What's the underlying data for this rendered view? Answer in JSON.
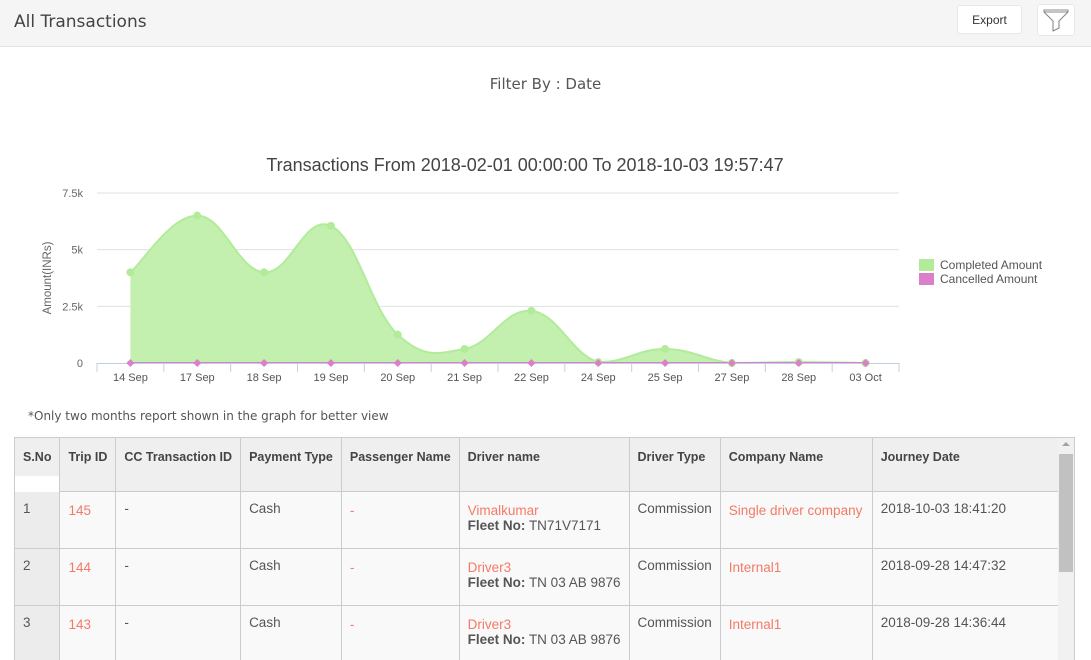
{
  "header": {
    "title": "All Transactions",
    "export_label": "Export",
    "filter_icon": "filter-funnel-icon"
  },
  "filter_by": "Filter By : Date",
  "note": "*Only two months report shown in the graph for better view",
  "colors": {
    "accent_link": "#f47a66",
    "completed": "#b2eb9a",
    "cancelled": "#dc7fcb"
  },
  "chart_data": {
    "type": "area",
    "title": "Transactions From 2018-02-01 00:00:00 To 2018-10-03 19:57:47",
    "xlabel": "",
    "ylabel": "Amount(INRs)",
    "ylim": [
      0,
      7500
    ],
    "yticks": [
      0,
      2500,
      5000,
      7500
    ],
    "ytick_labels": [
      "0",
      "2.5k",
      "5k",
      "7.5k"
    ],
    "grid": true,
    "legend_position": "right",
    "categories": [
      "14 Sep",
      "17 Sep",
      "18 Sep",
      "19 Sep",
      "20 Sep",
      "21 Sep",
      "22 Sep",
      "24 Sep",
      "25 Sep",
      "27 Sep",
      "28 Sep",
      "03 Oct"
    ],
    "series": [
      {
        "name": "Completed Amount",
        "values": [
          4000,
          6500,
          4000,
          6050,
          1250,
          620,
          2300,
          40,
          620,
          0,
          40,
          0
        ]
      },
      {
        "name": "Cancelled Amount",
        "values": [
          0,
          0,
          0,
          0,
          0,
          0,
          0,
          0,
          0,
          0,
          0,
          0
        ]
      }
    ]
  },
  "table": {
    "columns": [
      "S.No",
      "Trip ID",
      "CC Transaction ID",
      "Payment Type",
      "Passenger Name",
      "Driver name",
      "Driver Type",
      "Company Name",
      "Journey Date"
    ],
    "fleet_label": "Fleet No:",
    "rows": [
      {
        "sno": "1",
        "trip_id": "145",
        "cc_id": "-",
        "payment": "Cash",
        "passenger": "-",
        "driver": "Vimalkumar",
        "fleet": "TN71V7171",
        "driver_type": "Commission",
        "company": "Single driver company",
        "date": "2018-10-03 18:41:20"
      },
      {
        "sno": "2",
        "trip_id": "144",
        "cc_id": "-",
        "payment": "Cash",
        "passenger": "-",
        "driver": "Driver3",
        "fleet": "TN 03 AB 9876",
        "driver_type": "Commission",
        "company": "Internal1",
        "date": "2018-09-28 14:47:32"
      },
      {
        "sno": "3",
        "trip_id": "143",
        "cc_id": "-",
        "payment": "Cash",
        "passenger": "-",
        "driver": "Driver3",
        "fleet": "TN 03 AB 9876",
        "driver_type": "Commission",
        "company": "Internal1",
        "date": "2018-09-28 14:36:44"
      }
    ]
  }
}
